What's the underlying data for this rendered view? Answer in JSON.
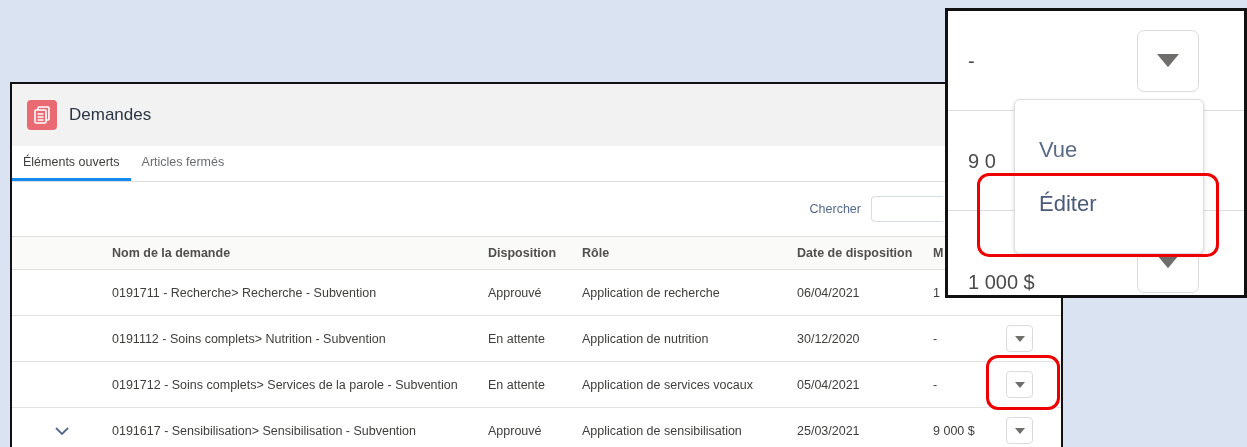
{
  "panel": {
    "title": "Demandes"
  },
  "tabs": [
    {
      "label": "Éléments ouverts",
      "selected": true
    },
    {
      "label": "Articles fermés",
      "selected": false
    }
  ],
  "search": {
    "label": "Chercher"
  },
  "table": {
    "columns": [
      "Nom de la demande",
      "Disposition",
      "Rôle",
      "Date de disposition",
      "M"
    ],
    "rows": [
      {
        "toggle": false,
        "actions": false,
        "cells": [
          "0191711 - Recherche> Recherche - Subvention",
          "Approuvé",
          "Application de recherche",
          "06/04/2021",
          "1"
        ]
      },
      {
        "toggle": false,
        "actions": true,
        "cells": [
          "0191112 - Soins complets> Nutrition - Subvention",
          "En attente",
          "Application de nutrition",
          "30/12/2020",
          "-"
        ]
      },
      {
        "toggle": false,
        "actions": true,
        "cells": [
          "0191712 - Soins complets> Services de la parole - Subvention",
          "En attente",
          "Application de services vocaux",
          "05/04/2021",
          "-"
        ]
      },
      {
        "toggle": true,
        "actions": true,
        "cells": [
          "0191617 - Sensibilisation> Sensibilisation - Subvention",
          "Approuvé",
          "Application de sensibilisation",
          "25/03/2021",
          "9 000 $"
        ]
      }
    ]
  },
  "zoom_inset": {
    "values": [
      "-",
      "9 0",
      "1 000 $"
    ],
    "menu": [
      {
        "label": "Vue",
        "selected": false
      },
      {
        "label": "Éditer",
        "selected": true
      }
    ]
  }
}
